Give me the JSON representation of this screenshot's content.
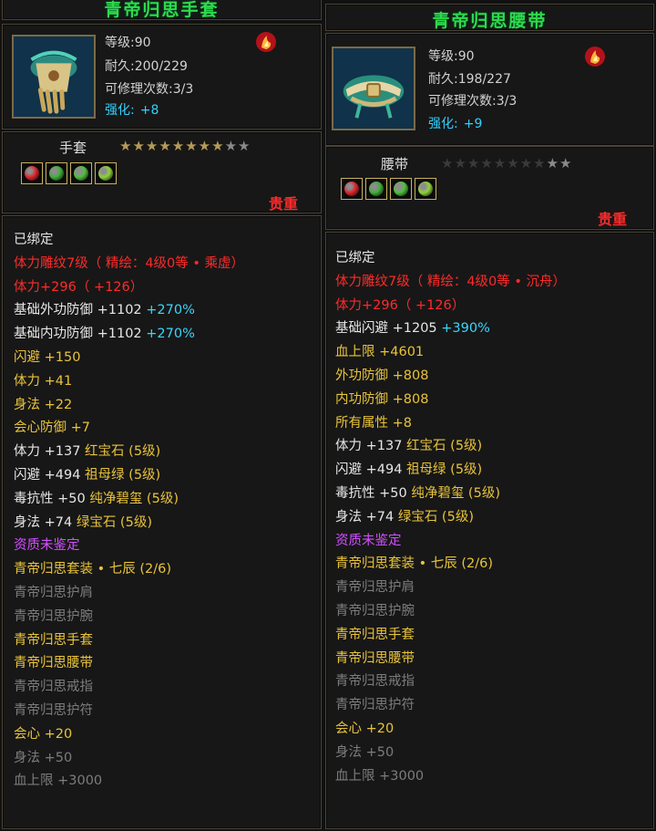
{
  "left": {
    "title": "青帝归思手套",
    "stats": {
      "level_label": "等级:",
      "level_value": "90",
      "durability_label": "耐久:",
      "durability_value": "200/229",
      "repair_label": "可修理次数:",
      "repair_value": "3/3",
      "enhance_label": "强化:",
      "enhance_value": "+8"
    },
    "type_label": "手套",
    "stars": {
      "on": "★★★★★★★★",
      "off": "★★"
    },
    "gems": [
      "#e0262b",
      "#3fb03a",
      "#4fc03c",
      "#8ed43a"
    ],
    "rarity": "贵重",
    "lines": [
      {
        "parts": [
          {
            "text": "已绑定",
            "color": "white"
          }
        ]
      },
      {
        "parts": [
          {
            "text": "体力雕纹7级（ 精绘：4级0等 • 乘虚）",
            "color": "red"
          }
        ]
      },
      {
        "parts": [
          {
            "text": "体力+296（ +126）",
            "color": "red"
          }
        ]
      },
      {
        "parts": [
          {
            "text": "基础外功防御 +1102 ",
            "color": "white"
          },
          {
            "text": "+270%",
            "color": "cyan"
          }
        ]
      },
      {
        "parts": [
          {
            "text": "基础内功防御 +1102 ",
            "color": "white"
          },
          {
            "text": "+270%",
            "color": "cyan"
          }
        ]
      },
      {
        "parts": [
          {
            "text": "闪避 +150",
            "color": "gold"
          }
        ]
      },
      {
        "parts": [
          {
            "text": "体力 +41",
            "color": "gold"
          }
        ]
      },
      {
        "parts": [
          {
            "text": "身法 +22",
            "color": "gold"
          }
        ]
      },
      {
        "parts": [
          {
            "text": "会心防御 +7",
            "color": "gold"
          }
        ]
      },
      {
        "parts": [
          {
            "text": "体力 +137 ",
            "color": "white"
          },
          {
            "text": "红宝石 (5级)",
            "color": "gold"
          }
        ]
      },
      {
        "parts": [
          {
            "text": "闪避 +494 ",
            "color": "white"
          },
          {
            "text": "祖母绿 (5级)",
            "color": "gold"
          }
        ]
      },
      {
        "parts": [
          {
            "text": "毒抗性 +50 ",
            "color": "white"
          },
          {
            "text": "纯净碧玺 (5级)",
            "color": "gold"
          }
        ]
      },
      {
        "parts": [
          {
            "text": "身法 +74 ",
            "color": "white"
          },
          {
            "text": "绿宝石 (5级)",
            "color": "gold"
          }
        ]
      },
      {
        "parts": [
          {
            "text": "资质未鉴定",
            "color": "purple"
          }
        ]
      },
      {
        "parts": [
          {
            "text": "青帝归思套装 • 七辰  (2/6)",
            "color": "gold"
          }
        ]
      },
      {
        "parts": [
          {
            "text": "青帝归思护肩",
            "color": "grey"
          }
        ]
      },
      {
        "parts": [
          {
            "text": "青帝归思护腕",
            "color": "grey"
          }
        ]
      },
      {
        "parts": [
          {
            "text": "青帝归思手套",
            "color": "gold"
          }
        ]
      },
      {
        "parts": [
          {
            "text": "青帝归思腰带",
            "color": "gold"
          }
        ]
      },
      {
        "parts": [
          {
            "text": "青帝归思戒指",
            "color": "grey"
          }
        ]
      },
      {
        "parts": [
          {
            "text": "青帝归思护符",
            "color": "grey"
          }
        ]
      },
      {
        "parts": [
          {
            "text": "会心 +20",
            "color": "gold"
          }
        ]
      },
      {
        "parts": [
          {
            "text": "身法 +50",
            "color": "grey"
          }
        ]
      },
      {
        "parts": [
          {
            "text": "血上限 +3000",
            "color": "grey"
          }
        ]
      }
    ]
  },
  "right": {
    "title": "青帝归思腰带",
    "stats": {
      "level_label": "等级:",
      "level_value": "90",
      "durability_label": "耐久:",
      "durability_value": "198/227",
      "repair_label": "可修理次数:",
      "repair_value": "3/3",
      "enhance_label": "强化:",
      "enhance_value": "+9"
    },
    "type_label": "腰带",
    "stars": {
      "on": "★★★★★★★★",
      "off": "★★"
    },
    "gems": [
      "#e0262b",
      "#3fb03a",
      "#4fc03c",
      "#8ed43a"
    ],
    "rarity": "贵重",
    "lines": [
      {
        "parts": [
          {
            "text": "已绑定",
            "color": "white"
          }
        ]
      },
      {
        "parts": [
          {
            "text": "体力雕纹7级（ 精绘：4级0等 • 沉舟）",
            "color": "red"
          }
        ]
      },
      {
        "parts": [
          {
            "text": "体力+296（ +126）",
            "color": "red"
          }
        ]
      },
      {
        "parts": [
          {
            "text": "基础闪避 +1205 ",
            "color": "white"
          },
          {
            "text": "+390%",
            "color": "cyan"
          }
        ]
      },
      {
        "parts": [
          {
            "text": "血上限 +4601",
            "color": "gold"
          }
        ]
      },
      {
        "parts": [
          {
            "text": "外功防御 +808",
            "color": "gold"
          }
        ]
      },
      {
        "parts": [
          {
            "text": "内功防御 +808",
            "color": "gold"
          }
        ]
      },
      {
        "parts": [
          {
            "text": "所有属性 +8",
            "color": "gold"
          }
        ]
      },
      {
        "parts": [
          {
            "text": "体力 +137 ",
            "color": "white"
          },
          {
            "text": "红宝石 (5级)",
            "color": "gold"
          }
        ]
      },
      {
        "parts": [
          {
            "text": "闪避 +494 ",
            "color": "white"
          },
          {
            "text": "祖母绿 (5级)",
            "color": "gold"
          }
        ]
      },
      {
        "parts": [
          {
            "text": "毒抗性 +50 ",
            "color": "white"
          },
          {
            "text": "纯净碧玺 (5级)",
            "color": "gold"
          }
        ]
      },
      {
        "parts": [
          {
            "text": "身法 +74 ",
            "color": "white"
          },
          {
            "text": "绿宝石 (5级)",
            "color": "gold"
          }
        ]
      },
      {
        "parts": [
          {
            "text": "资质未鉴定",
            "color": "purple"
          }
        ]
      },
      {
        "parts": [
          {
            "text": "青帝归思套装 • 七辰  (2/6)",
            "color": "gold"
          }
        ]
      },
      {
        "parts": [
          {
            "text": "青帝归思护肩",
            "color": "grey"
          }
        ]
      },
      {
        "parts": [
          {
            "text": "青帝归思护腕",
            "color": "grey"
          }
        ]
      },
      {
        "parts": [
          {
            "text": "青帝归思手套",
            "color": "gold"
          }
        ]
      },
      {
        "parts": [
          {
            "text": "青帝归思腰带",
            "color": "gold"
          }
        ]
      },
      {
        "parts": [
          {
            "text": "青帝归思戒指",
            "color": "grey"
          }
        ]
      },
      {
        "parts": [
          {
            "text": "青帝归思护符",
            "color": "grey"
          }
        ]
      },
      {
        "parts": [
          {
            "text": "会心 +20",
            "color": "gold"
          }
        ]
      },
      {
        "parts": [
          {
            "text": "身法 +50",
            "color": "grey"
          }
        ]
      },
      {
        "parts": [
          {
            "text": "血上限 +3000",
            "color": "grey"
          }
        ]
      }
    ]
  }
}
